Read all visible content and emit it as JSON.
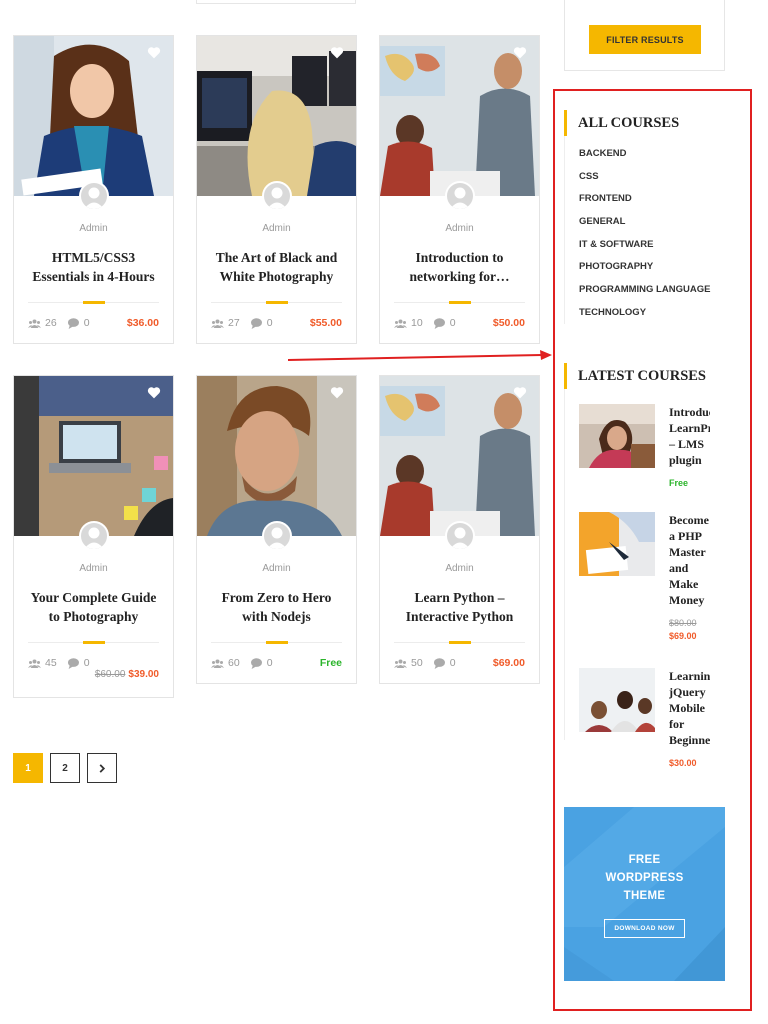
{
  "filter": {
    "button_label": "FILTER RESULTS"
  },
  "courses": [
    {
      "author": "Admin",
      "title": "HTML5/CSS3 Essentials in 4-Hours",
      "students": "26",
      "comments": "0",
      "price": "$36.00",
      "price_type": "paid"
    },
    {
      "author": "Admin",
      "title": "The Art of Black and White Photography",
      "students": "27",
      "comments": "0",
      "price": "$55.00",
      "price_type": "paid"
    },
    {
      "author": "Admin",
      "title": "Introduction to networking for…",
      "students": "10",
      "comments": "0",
      "price": "$50.00",
      "price_type": "paid"
    },
    {
      "author": "Admin",
      "title": "Your Complete Guide to Photography",
      "students": "45",
      "comments": "0",
      "old_price": "$60.00",
      "price": "$39.00",
      "price_type": "sale"
    },
    {
      "author": "Admin",
      "title": "From Zero to Hero with Nodejs",
      "students": "60",
      "comments": "0",
      "price": "Free",
      "price_type": "free"
    },
    {
      "author": "Admin",
      "title": "Learn Python – Interactive Python",
      "students": "50",
      "comments": "0",
      "price": "$69.00",
      "price_type": "paid"
    }
  ],
  "pagination": {
    "pages": [
      "1",
      "2"
    ],
    "current": "1",
    "next_icon": "chevron-right-icon"
  },
  "sidebar": {
    "all_courses_title": "ALL COURSES",
    "categories": [
      "BACKEND",
      "CSS",
      "FRONTEND",
      "GENERAL",
      "IT & SOFTWARE",
      "PHOTOGRAPHY",
      "PROGRAMMING LANGUAGE",
      "TECHNOLOGY"
    ],
    "latest_title": "LATEST COURSES",
    "latest": [
      {
        "title_lines": [
          "Introduc",
          "LearnPr",
          "– LMS",
          "plugin"
        ],
        "price": "Free",
        "price_type": "free"
      },
      {
        "title_lines": [
          "Become",
          "a PHP",
          "Master",
          "and",
          "Make",
          "Money"
        ],
        "old_price": "$80.00",
        "price": "$69.00",
        "price_type": "sale"
      },
      {
        "title_lines": [
          "Learnin",
          "jQuery",
          "Mobile",
          "for",
          "Beginne"
        ],
        "price": "$30.00",
        "price_type": "paid"
      }
    ],
    "banner": {
      "lines": [
        "FREE",
        "WORDPRESS",
        "THEME"
      ],
      "button": "DOWNLOAD NOW"
    }
  },
  "colors": {
    "accent": "#f5b700",
    "price": "#f05b2a",
    "free": "#2bb42b",
    "annotation": "#e02020",
    "banner": "#4aa2e2"
  }
}
